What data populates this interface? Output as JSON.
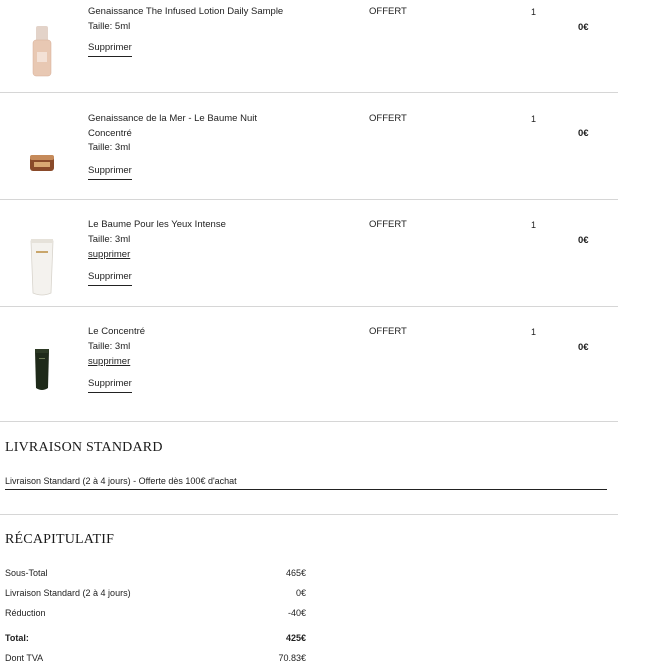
{
  "cart": {
    "items": [
      {
        "name": "Genaissance The Infused Lotion Daily Sample",
        "size": "Taille: 5ml",
        "price_label": "OFFERT",
        "quantity": "1",
        "total": "0€",
        "remove_label": "Supprimer",
        "image": "lotion-bottle-icon"
      },
      {
        "name_line1": "Genaissance de la Mer - Le Baume Nuit",
        "name_line2": "Concentré",
        "size": "Taille: 3ml",
        "price_label": "OFFERT",
        "quantity": "1",
        "total": "0€",
        "remove_label": "Supprimer",
        "image": "cream-jar-icon"
      },
      {
        "name": "Le Baume Pour les Yeux Intense",
        "size": "Taille: 3ml",
        "inline_remove": "supprimer",
        "price_label": "OFFERT",
        "quantity": "1",
        "total": "0€",
        "remove_label": "Supprimer",
        "image": "eye-balm-tube-icon"
      },
      {
        "name": "Le Concentré",
        "size": "Taille: 3ml",
        "inline_remove": "supprimer",
        "price_label": "OFFERT",
        "quantity": "1",
        "total": "0€",
        "remove_label": "Supprimer",
        "image": "concentre-tube-icon"
      }
    ]
  },
  "shipping": {
    "title": "LIVRAISON STANDARD",
    "option": "Livraison Standard (2 à 4 jours) - Offerte dès 100€ d'achat"
  },
  "summary": {
    "title": "RÉCAPITULATIF",
    "rows": [
      {
        "label": "Sous-Total",
        "value": "465€"
      },
      {
        "label": "Livraison Standard (2 à 4 jours)",
        "value": "0€"
      },
      {
        "label": "Réduction",
        "value": "-40€"
      },
      {
        "label": "Total:",
        "value": "425€"
      },
      {
        "label": "Dont TVA",
        "value": "70.83€"
      }
    ]
  },
  "colors": {
    "text": "#222222",
    "divider": "#d6d6d6",
    "tube_dark": "#1f2a1a",
    "lotion": "#e8c8b3"
  }
}
